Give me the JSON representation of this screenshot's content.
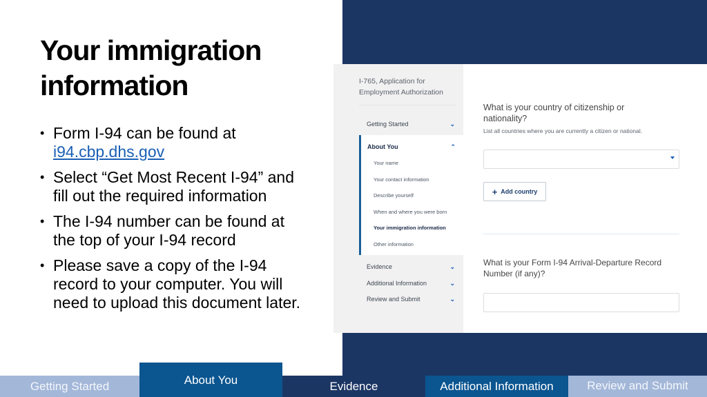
{
  "slide": {
    "title": "Your immigration information",
    "bullets": [
      {
        "text": "Form I-94 can be found at",
        "link": "i94.cbp.dhs.gov"
      },
      {
        "text": "Select “Get Most Recent I-94” and fill out the required information"
      },
      {
        "text": "The I-94 number can be found at the top of your I-94 record"
      },
      {
        "text": "Please save a copy of the I-94 record to your computer. You will need to upload this document later."
      }
    ],
    "bullet_glyph": "•"
  },
  "screenshot": {
    "app_title": "I-765, Application for Employment Authorization",
    "sidebar": {
      "sections": [
        {
          "label": "Getting Started",
          "icon": "chevron-down-icon",
          "glyph": "⌄"
        },
        {
          "label": "About You",
          "icon": "chevron-up-icon",
          "glyph": "⌃",
          "expanded": true
        },
        {
          "label": "Evidence",
          "icon": "chevron-down-icon",
          "glyph": "⌄"
        },
        {
          "label": "Additional Information",
          "icon": "chevron-down-icon",
          "glyph": "⌄"
        },
        {
          "label": "Review and Submit",
          "icon": "chevron-down-icon",
          "glyph": "⌄"
        }
      ],
      "about_items": [
        "Your name",
        "Your contact information",
        "Describe yourself",
        "When and where you were born",
        "Your immigration information",
        "Other information"
      ],
      "active_item": "Your immigration information"
    },
    "main": {
      "citizenship_question": "What is your country of citizenship or nationality?",
      "citizenship_hint": "List all countries where you are currently a citizen or national.",
      "country_select_value": "",
      "add_country_label": "Add country",
      "add_country_icon": "+",
      "i94_question": "What is your Form I-94 Arrival-Departure Record Number (if any)?",
      "i94_input_value": ""
    }
  },
  "progress_tabs": [
    {
      "label": "Getting Started",
      "state": "inactive"
    },
    {
      "label": "About You",
      "state": "current"
    },
    {
      "label": "Evidence",
      "state": "upcoming"
    },
    {
      "label": "Additional Information",
      "state": "upcoming"
    },
    {
      "label": "Review and Submit",
      "state": "inactive"
    }
  ],
  "colors": {
    "navy": "#1c3664",
    "current_blue": "#0b5590",
    "light_blue": "#a3b7d8",
    "link_blue": "#1a5fb4"
  }
}
